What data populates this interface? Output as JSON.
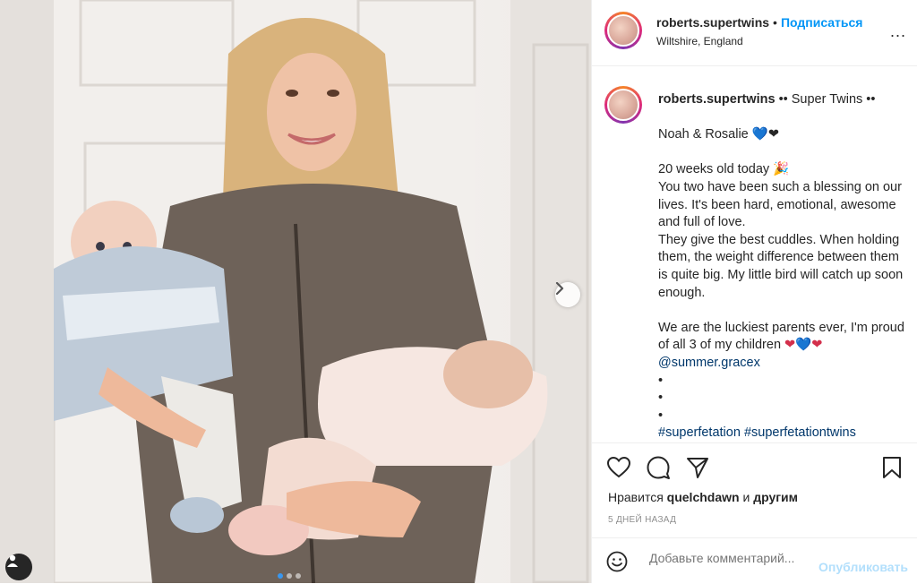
{
  "header": {
    "username": "roberts.supertwins",
    "separator": "•",
    "follow_label": "Подписаться",
    "location": "Wiltshire, England",
    "more_label": "..."
  },
  "caption": {
    "username": "roberts.supertwins",
    "title_suffix": "•• Super Twins ••",
    "line1": "Noah & Rosalie",
    "line1_emoji": "💙❤",
    "line2": "20 weeks old today",
    "line2_emoji": "🎉",
    "line3": "You two have been such a blessing on our lives. It's been hard, emotional, awesome and full of love.",
    "line4": "They give the best cuddles. When holding them, the weight difference between them is quite big. My little bird will catch up soon enough.",
    "line5": "We are the luckiest parents ever, I'm proud of all 3 of my children",
    "line5_emoji_1": "❤",
    "line5_emoji_2": "💙",
    "line5_emoji_3": "❤",
    "mention": "@summer.gracex",
    "bullet": "•",
    "hashtag1": "#superfetation",
    "hashtag2": "#superfetationtwins"
  },
  "likes": {
    "prefix": "Нравится",
    "user": "quelchdawn",
    "conj": "и",
    "others": "другим"
  },
  "timestamp": "5 ДНЕЙ НАЗАД",
  "comment": {
    "placeholder": "Добавьте комментарий...",
    "publish_label": "Опубликовать"
  },
  "carousel": {
    "current": 1,
    "total": 3
  },
  "colors": {
    "link": "#0095f6",
    "hashtag": "#00376b",
    "muted": "#8e8e8e",
    "publish_disabled": "#b2dffc"
  }
}
